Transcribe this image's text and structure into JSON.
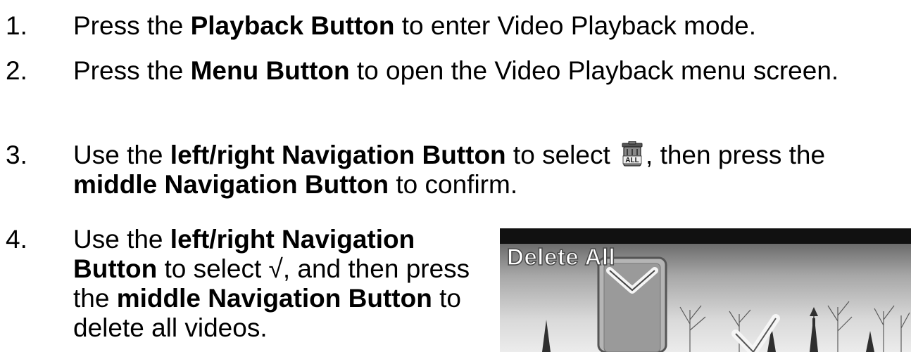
{
  "steps": [
    {
      "number": "1.",
      "parts": [
        "Press the ",
        "Playback Button",
        " to enter Video Playback mode."
      ]
    },
    {
      "number": "2.",
      "parts": [
        "Press the ",
        "Menu Button",
        " to open the Video Playback menu screen."
      ]
    },
    {
      "number": "3.",
      "parts": [
        "Use the ",
        "left/right Navigation Button",
        " to select ",
        ", then press the ",
        "middle Navigation Button",
        " to confirm."
      ],
      "icon": "delete-all-icon"
    },
    {
      "number": "4.",
      "parts": [
        "Use the ",
        "left/right Navigation Button",
        " to select √, and then press the ",
        "middle Navigation Button",
        " to delete all videos."
      ]
    }
  ],
  "screen": {
    "title": "Delete All",
    "icons": [
      "cancel-x-icon",
      "confirm-check-icon"
    ]
  }
}
